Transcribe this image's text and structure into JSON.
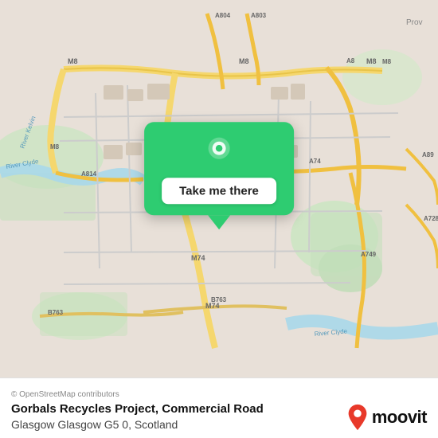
{
  "map": {
    "alt": "Map of Glasgow area showing Gorbals Recycles Project location"
  },
  "popup": {
    "button_label": "Take me there",
    "pin_alt": "location-pin"
  },
  "footer": {
    "copyright": "© OpenStreetMap contributors",
    "location_name": "Gorbals Recycles Project, Commercial Road",
    "location_address": "Glasgow Glasgow G5 0, Scotland"
  },
  "branding": {
    "logo_text": "moovit"
  },
  "colors": {
    "popup_green": "#2ecc71",
    "moovit_red": "#e8392a"
  }
}
